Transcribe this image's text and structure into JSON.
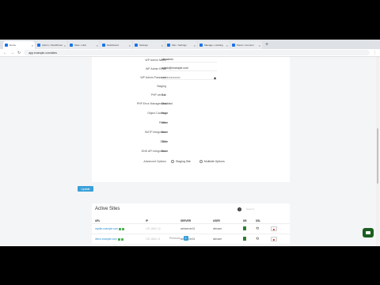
{
  "browser": {
    "tabs": [
      {
        "label": "Home"
      },
      {
        "label": "Admin • WordPress"
      },
      {
        "label": "Sites • Hub"
      },
      {
        "label": "Dashboard"
      },
      {
        "label": "Settings"
      },
      {
        "label": "Site • Settings"
      },
      {
        "label": "Manage • Hosting"
      },
      {
        "label": "Panel • Connect"
      }
    ],
    "url": "app.example.com/sites"
  },
  "form": {
    "fields": [
      {
        "label": "WP Admin Name",
        "value": "siteadmin"
      },
      {
        "label": "WP Admin Email",
        "value": "admin@example.com"
      },
      {
        "label": "WP Admin Password",
        "value": "••••••••••••••"
      },
      {
        "label": "Staging",
        "value": ""
      },
      {
        "label": "PHP version",
        "value": "7.4"
      },
      {
        "label": "PHP Error Management",
        "value": "Disabled"
      },
      {
        "label": "Object Caching",
        "value": "None"
      },
      {
        "label": "Redis",
        "value": "None"
      },
      {
        "label": "SMTP Integration",
        "value": "None"
      },
      {
        "label": "CDN",
        "value": "None"
      },
      {
        "label": "DNS API Integration",
        "value": "None"
      }
    ],
    "advanced_options": {
      "label": "Advanced Options",
      "options": [
        "Staging Site",
        "Multisite Options"
      ]
    },
    "update_label": "Update"
  },
  "active_sites": {
    "title": "Active Sites",
    "search_placeholder": "Search...",
    "columns": [
      "URL",
      "IP",
      "SERVER",
      "USER",
      "DB",
      "SSL"
    ],
    "rows": [
      {
        "url": "mysite.example.com",
        "ip": "192.168.0.10",
        "server": "webserver01",
        "user": "siteuser"
      },
      {
        "url": "demo.example.com",
        "ip": "192.168.0.11",
        "server": "webserver01",
        "user": "siteuser"
      }
    ]
  },
  "pagination": {
    "prev": "Previous",
    "current": "1"
  }
}
